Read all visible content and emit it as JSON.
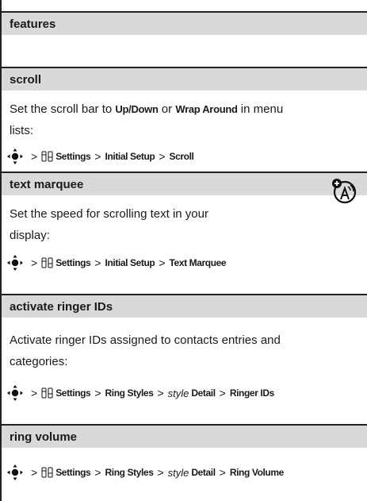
{
  "header": {
    "title": "features"
  },
  "sections": [
    {
      "title": "scroll",
      "text_before": "Set the scroll bar to ",
      "opt1": "Up/Down",
      "text_mid": " or ",
      "opt2": "Wrap Around",
      "text_after1": " in menu",
      "text_after2": "lists:",
      "path": {
        "settings": "Settings",
        "p2": "Initial Setup",
        "p3": "Scroll"
      }
    },
    {
      "title": "text marquee",
      "line1": "Set the speed for scrolling text in your",
      "line2": "display:",
      "path": {
        "settings": "Settings",
        "p2": "Initial Setup",
        "p3": "Text Marquee"
      }
    },
    {
      "title": "activate ringer IDs",
      "line1": "Activate ringer IDs assigned to contacts entries and",
      "line2": "categories:",
      "path": {
        "settings": "Settings",
        "p2": "Ring Styles",
        "style": "style",
        "p3": "Detail",
        "p4": "Ringer IDs"
      }
    },
    {
      "title": "ring volume",
      "path": {
        "settings": "Settings",
        "p2": "Ring Styles",
        "style": "style",
        "p3": "Detail",
        "p4": "Ring Volume"
      }
    }
  ],
  "sep": ">"
}
